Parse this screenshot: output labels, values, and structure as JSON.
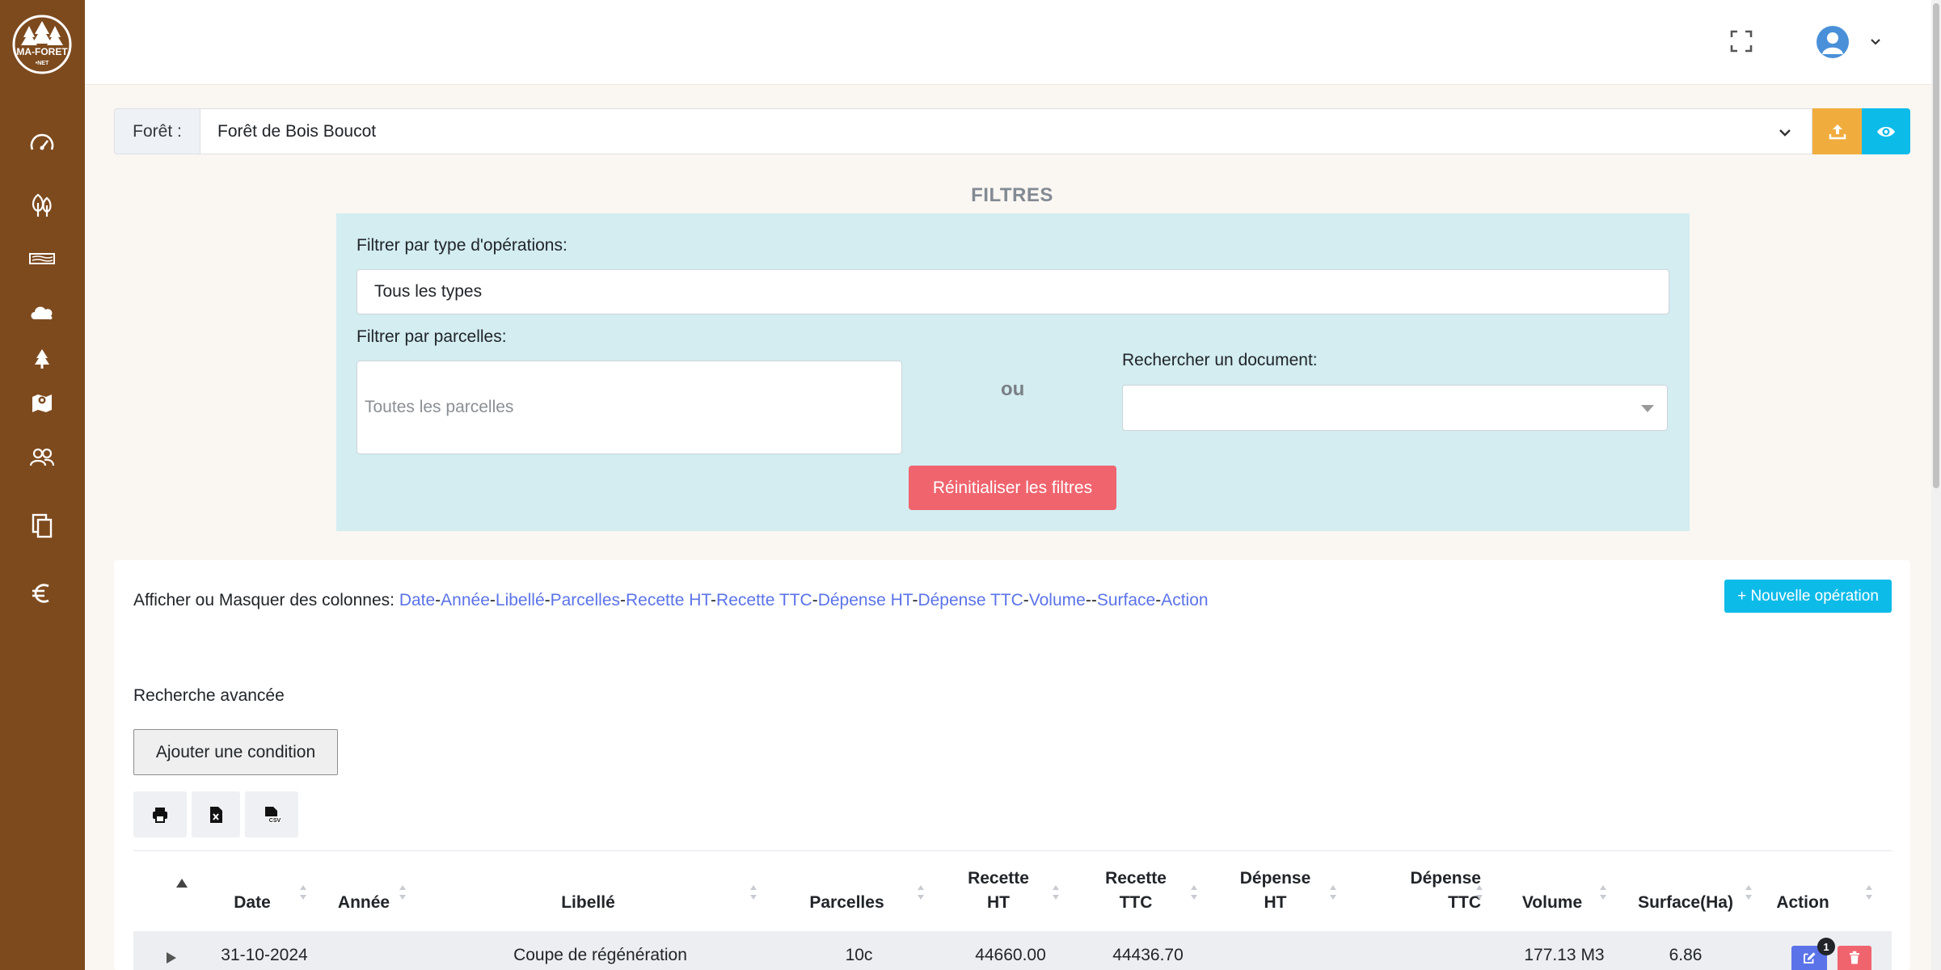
{
  "app": {
    "logo_text": "MA-FORET",
    "logo_sub": "•NET"
  },
  "sidebar": {
    "items": [
      {
        "icon": "dashboard-gauge-icon"
      },
      {
        "icon": "trees-icon"
      },
      {
        "icon": "wood-planks-icon"
      },
      {
        "icon": "cloud-icon"
      },
      {
        "icon": "fir-tree-icon"
      },
      {
        "icon": "map-icon"
      },
      {
        "icon": "users-icon"
      },
      {
        "icon": "documents-icon"
      },
      {
        "icon": "euro-icon"
      }
    ]
  },
  "topbar": {
    "fullscreen_icon": "fullscreen-icon",
    "avatar_icon": "user-avatar-icon",
    "menu_icon": "chevron-down-icon"
  },
  "forest": {
    "label": "Forêt :",
    "selected": "Forêt de Bois Boucot"
  },
  "filters": {
    "title": "FILTRES",
    "type_label": "Filtrer par type d'opérations:",
    "type_value": "Tous les types",
    "parcel_label": "Filtrer par parcelles:",
    "parcel_placeholder": "Toutes les parcelles",
    "or": "ou",
    "doc_label": "Rechercher un document:",
    "reset": "Réinitialiser les filtres"
  },
  "columns_toggle": {
    "prefix": "Afficher ou Masquer des colonnes:",
    "items": [
      "Date",
      "Année",
      "Libellé",
      "Parcelles",
      "Recette HT",
      "Recette TTC",
      "Dépense HT",
      "Dépense TTC",
      "Volume",
      "Surface",
      "Action"
    ],
    "separators": [
      "-",
      "-",
      "-",
      "-",
      "-",
      "-",
      "-",
      "-",
      "--",
      "-"
    ]
  },
  "new_operation": "+ Nouvelle opération",
  "advanced_search": {
    "title": "Recherche avancée",
    "add_condition": "Ajouter une condition"
  },
  "export": {
    "print_icon": "printer-icon",
    "excel_icon": "excel-file-icon",
    "csv_icon": "csv-file-icon"
  },
  "table": {
    "headers": {
      "date": "Date",
      "annee": "Année",
      "libelle": "Libellé",
      "parcelles": "Parcelles",
      "recette_ht_1": "Recette",
      "recette_ht_2": "HT",
      "recette_ttc_1": "Recette",
      "recette_ttc_2": "TTC",
      "depense_ht_1": "Dépense",
      "depense_ht_2": "HT",
      "depense_ttc_1": "Dépense",
      "depense_ttc_2": "TTC",
      "volume": "Volume",
      "surface": "Surface(Ha)",
      "action": "Action"
    },
    "rows": [
      {
        "date": "31-10-2024",
        "annee": "",
        "libelle": "Coupe de régénération",
        "parcelles": "10c",
        "recette_ht": "44660.00",
        "recette_ttc": "44436.70",
        "depense_ht": "",
        "depense_ttc": "",
        "volume": "177.13 M3",
        "surface": "6.86",
        "badge": "1"
      }
    ]
  }
}
